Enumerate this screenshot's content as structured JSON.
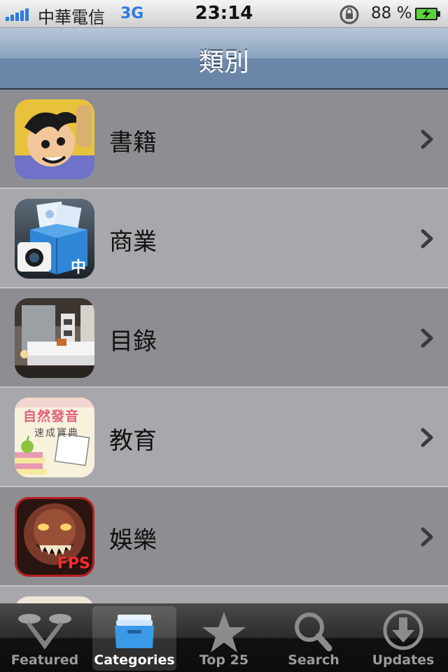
{
  "status_bar": {
    "carrier": "中華電信",
    "network": "3G",
    "time": "23:14",
    "battery_percent": "88 %",
    "icons": [
      "signal-bars-icon",
      "rotation-lock-icon",
      "battery-charging-icon"
    ]
  },
  "nav": {
    "title": "類別"
  },
  "categories": [
    {
      "label": "書籍",
      "icon": "books-category-icon"
    },
    {
      "label": "商業",
      "icon": "business-category-icon",
      "badge": "中"
    },
    {
      "label": "目錄",
      "icon": "catalogs-category-icon"
    },
    {
      "label": "教育",
      "icon": "education-category-icon",
      "lines": [
        "自然發音",
        "速成寶典"
      ]
    },
    {
      "label": "娛樂",
      "icon": "entertainment-category-icon",
      "badge": "FPS"
    }
  ],
  "tabs": [
    {
      "label": "Featured",
      "icon": "featured-icon",
      "selected": false
    },
    {
      "label": "Categories",
      "icon": "categories-icon",
      "selected": true
    },
    {
      "label": "Top 25",
      "icon": "star-icon",
      "selected": false
    },
    {
      "label": "Search",
      "icon": "search-icon",
      "selected": false
    },
    {
      "label": "Updates",
      "icon": "updates-icon",
      "selected": false
    }
  ],
  "colors": {
    "accent": "#2d7be0",
    "nav_bar": "#6d88aa",
    "tab_bar": "#111111"
  }
}
